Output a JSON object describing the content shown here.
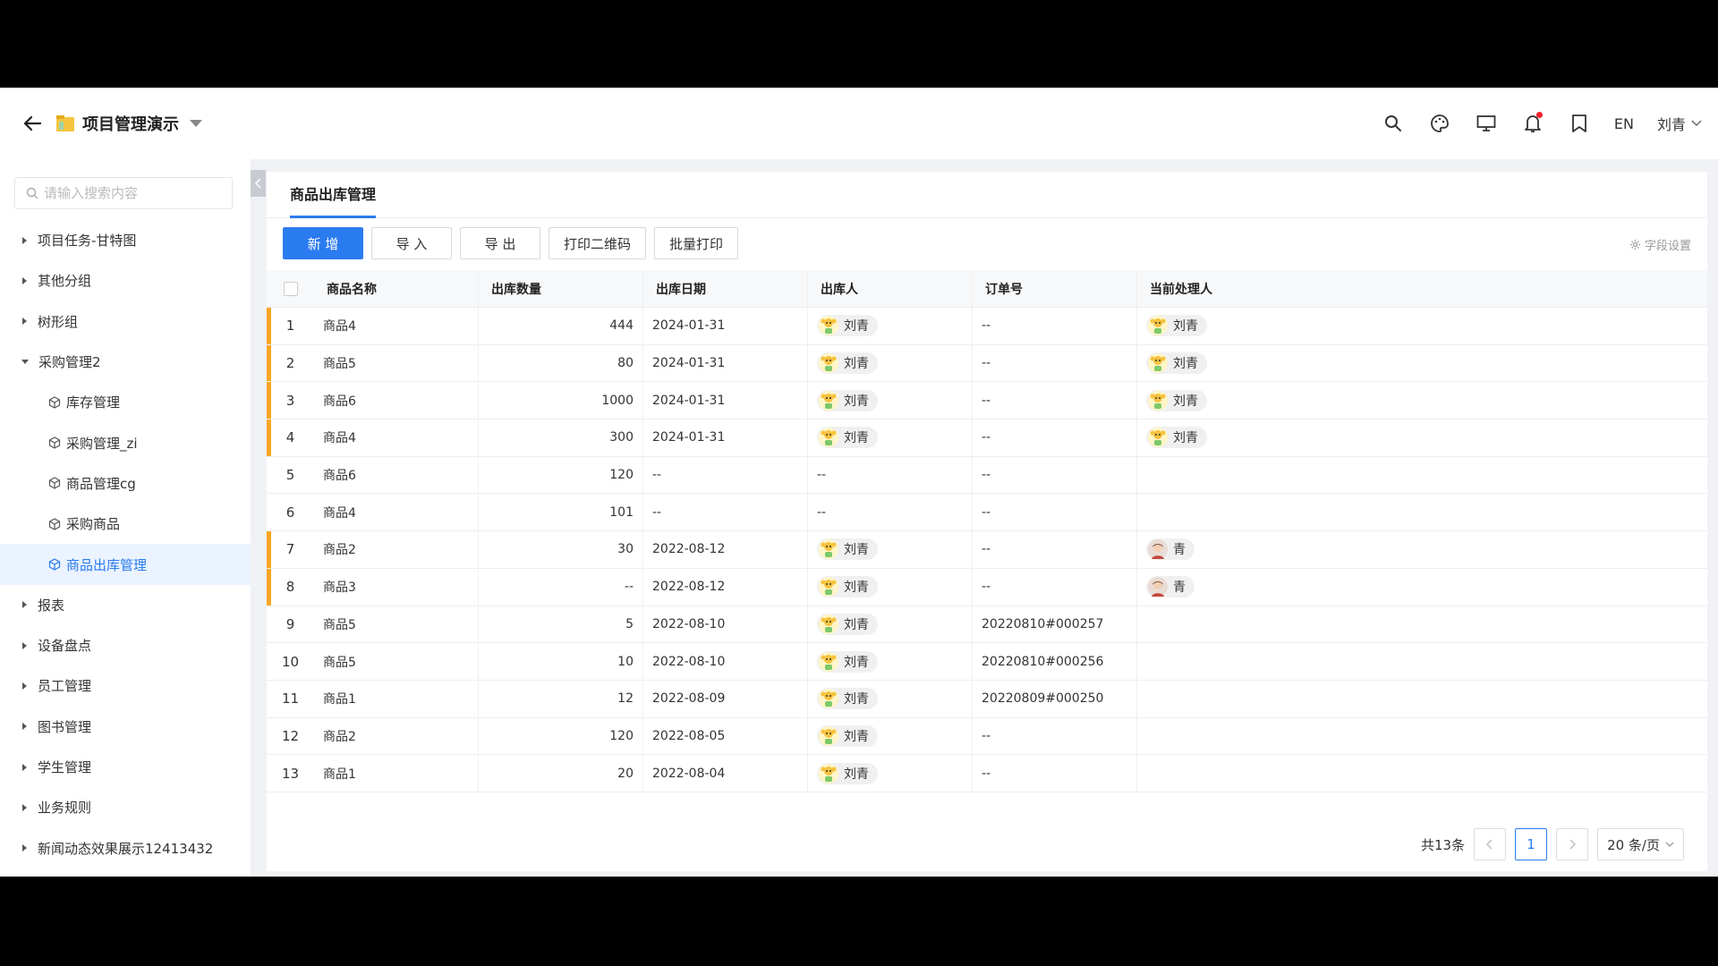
{
  "header": {
    "project_title": "项目管理演示",
    "lang": "EN",
    "user": "刘青"
  },
  "sidebar": {
    "search_placeholder": "请输入搜索内容",
    "items": [
      {
        "label": "项目任务-甘特图",
        "type": "group"
      },
      {
        "label": "其他分组",
        "type": "group"
      },
      {
        "label": "树形组",
        "type": "group"
      },
      {
        "label": "采购管理2",
        "type": "group-open"
      },
      {
        "label": "库存管理",
        "type": "sub"
      },
      {
        "label": "采购管理_zi",
        "type": "sub"
      },
      {
        "label": "商品管理cg",
        "type": "sub"
      },
      {
        "label": "采购商品",
        "type": "sub"
      },
      {
        "label": "商品出库管理",
        "type": "sub-active"
      },
      {
        "label": "报表",
        "type": "group"
      },
      {
        "label": "设备盘点",
        "type": "group"
      },
      {
        "label": "员工管理",
        "type": "group"
      },
      {
        "label": "图书管理",
        "type": "group"
      },
      {
        "label": "学生管理",
        "type": "group"
      },
      {
        "label": "业务规则",
        "type": "group"
      },
      {
        "label": "新闻动态效果展示12413432",
        "type": "group"
      }
    ]
  },
  "content": {
    "tab_label": "商品出库管理",
    "toolbar": {
      "add": "新 增",
      "import": "导 入",
      "export": "导 出",
      "print_qr": "打印二维码",
      "batch_print": "批量打印"
    },
    "field_settings": "字段设置",
    "columns": [
      "商品名称",
      "出库数量",
      "出库日期",
      "出库人",
      "订单号",
      "当前处理人"
    ],
    "rows": [
      {
        "no": "1",
        "name": "商品4",
        "qty": "444",
        "date": "2024-01-31",
        "person": "刘青",
        "order": "--",
        "handler": "刘青",
        "handler_type": "a",
        "flag": true
      },
      {
        "no": "2",
        "name": "商品5",
        "qty": "80",
        "date": "2024-01-31",
        "person": "刘青",
        "order": "--",
        "handler": "刘青",
        "handler_type": "a",
        "flag": true
      },
      {
        "no": "3",
        "name": "商品6",
        "qty": "1000",
        "date": "2024-01-31",
        "person": "刘青",
        "order": "--",
        "handler": "刘青",
        "handler_type": "a",
        "flag": true
      },
      {
        "no": "4",
        "name": "商品4",
        "qty": "300",
        "date": "2024-01-31",
        "person": "刘青",
        "order": "--",
        "handler": "刘青",
        "handler_type": "a",
        "flag": true
      },
      {
        "no": "5",
        "name": "商品6",
        "qty": "120",
        "date": "--",
        "person": "--",
        "order": "--",
        "handler": "",
        "handler_type": "",
        "flag": false
      },
      {
        "no": "6",
        "name": "商品4",
        "qty": "101",
        "date": "--",
        "person": "--",
        "order": "--",
        "handler": "",
        "handler_type": "",
        "flag": false
      },
      {
        "no": "7",
        "name": "商品2",
        "qty": "30",
        "date": "2022-08-12",
        "person": "刘青",
        "order": "--",
        "handler": "青",
        "handler_type": "b",
        "flag": true
      },
      {
        "no": "8",
        "name": "商品3",
        "qty": "--",
        "date": "2022-08-12",
        "person": "刘青",
        "order": "--",
        "handler": "青",
        "handler_type": "b",
        "flag": true
      },
      {
        "no": "9",
        "name": "商品5",
        "qty": "5",
        "date": "2022-08-10",
        "person": "刘青",
        "order": "20220810#000257",
        "handler": "",
        "handler_type": "",
        "flag": false
      },
      {
        "no": "10",
        "name": "商品5",
        "qty": "10",
        "date": "2022-08-10",
        "person": "刘青",
        "order": "20220810#000256",
        "handler": "",
        "handler_type": "",
        "flag": false
      },
      {
        "no": "11",
        "name": "商品1",
        "qty": "12",
        "date": "2022-08-09",
        "person": "刘青",
        "order": "20220809#000250",
        "handler": "",
        "handler_type": "",
        "flag": false
      },
      {
        "no": "12",
        "name": "商品2",
        "qty": "120",
        "date": "2022-08-05",
        "person": "刘青",
        "order": "--",
        "handler": "",
        "handler_type": "",
        "flag": false
      },
      {
        "no": "13",
        "name": "商品1",
        "qty": "20",
        "date": "2022-08-04",
        "person": "刘青",
        "order": "--",
        "handler": "",
        "handler_type": "",
        "flag": false
      }
    ],
    "pager": {
      "total": "共13条",
      "current": "1",
      "page_size": "20 条/页"
    }
  },
  "colors": {
    "primary": "#2b7bf0",
    "flag": "#f5a623"
  }
}
